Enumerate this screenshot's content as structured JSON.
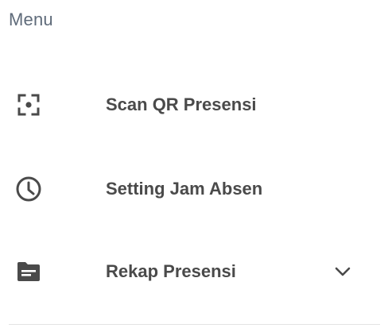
{
  "menu": {
    "title": "Menu",
    "items": [
      {
        "label": "Scan QR Presensi",
        "icon": "qr-scan-icon"
      },
      {
        "label": "Setting Jam Absen",
        "icon": "clock-icon"
      },
      {
        "label": "Rekap Presensi",
        "icon": "folder-icon",
        "expandable": true,
        "expand_icon": "chevron-down-icon"
      }
    ]
  },
  "colors": {
    "header_text": "#5f6b7a",
    "item_text": "#4a4a4a",
    "icon": "#4a4a4a",
    "divider": "#e3e3e3"
  }
}
